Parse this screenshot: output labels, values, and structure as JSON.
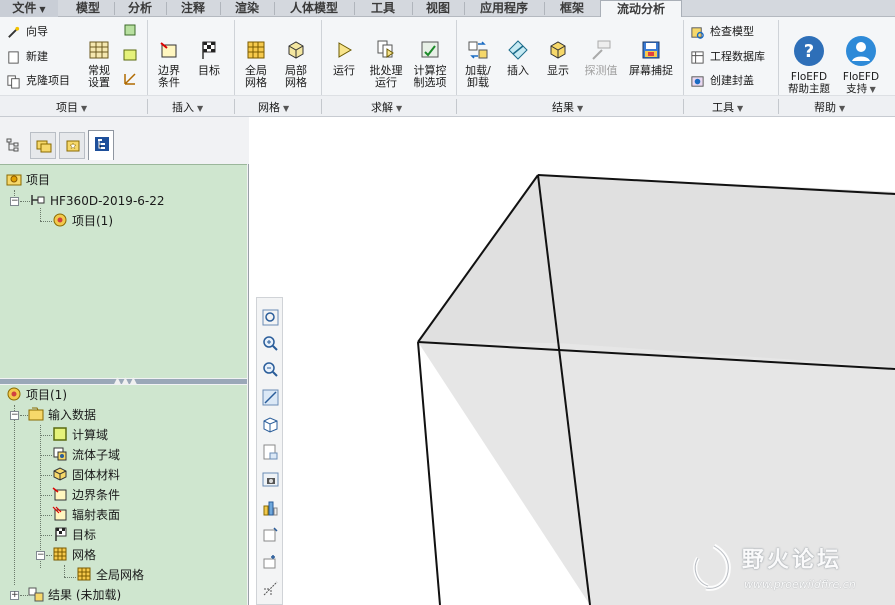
{
  "tabs": {
    "file": "文件",
    "items": [
      "模型",
      "分析",
      "注释",
      "渲染",
      "人体模型",
      "工具",
      "视图",
      "应用程序",
      "框架",
      "流动分析"
    ],
    "active": "流动分析"
  },
  "ribbon": {
    "project": {
      "wizard": "向导",
      "new": "新建",
      "clone": "克隆项目",
      "general_settings": "常规\n设置"
    },
    "insert": {
      "boundary": "边界\n条件",
      "goal": "目标"
    },
    "mesh": {
      "global": "全局\n网格",
      "local": "局部\n网格"
    },
    "solve": {
      "run": "运行",
      "batch": "批处理\n运行",
      "calc_control": "计算控\n制选项"
    },
    "results": {
      "load_unload": "加载/\n卸载",
      "insert": "插入",
      "display": "显示",
      "probe": "探测值",
      "screen_capture": "屏幕捕捉"
    },
    "tools": {
      "check_model": "检查模型",
      "engineering_db": "工程数据库",
      "create_lid": "创建封盖"
    },
    "help": {
      "help_topics": "FloEFD\n帮助主题",
      "support": "FloEFD\n支持"
    }
  },
  "group_labels": [
    "项目",
    "插入",
    "网格",
    "求解",
    "结果",
    "工具",
    "帮助"
  ],
  "tree_top": {
    "root": "项目",
    "model": "HF360D-2019-6-22",
    "project": "项目(1)"
  },
  "tree_bottom": {
    "root": "项目(1)",
    "input_data": "输入数据",
    "children": [
      "计算域",
      "流体子域",
      "固体材料",
      "边界条件",
      "辐射表面",
      "目标"
    ],
    "mesh": "网格",
    "global_mesh": "全局网格",
    "results": "结果 (未加载)"
  },
  "watermark": {
    "title": "野火论坛",
    "url": "www.proewildfire.cn"
  },
  "colors": {
    "tree_bg": "#cfe6cf",
    "ribbon_bg": "#f4f6f8",
    "box_fill": "#e6e6e6"
  }
}
